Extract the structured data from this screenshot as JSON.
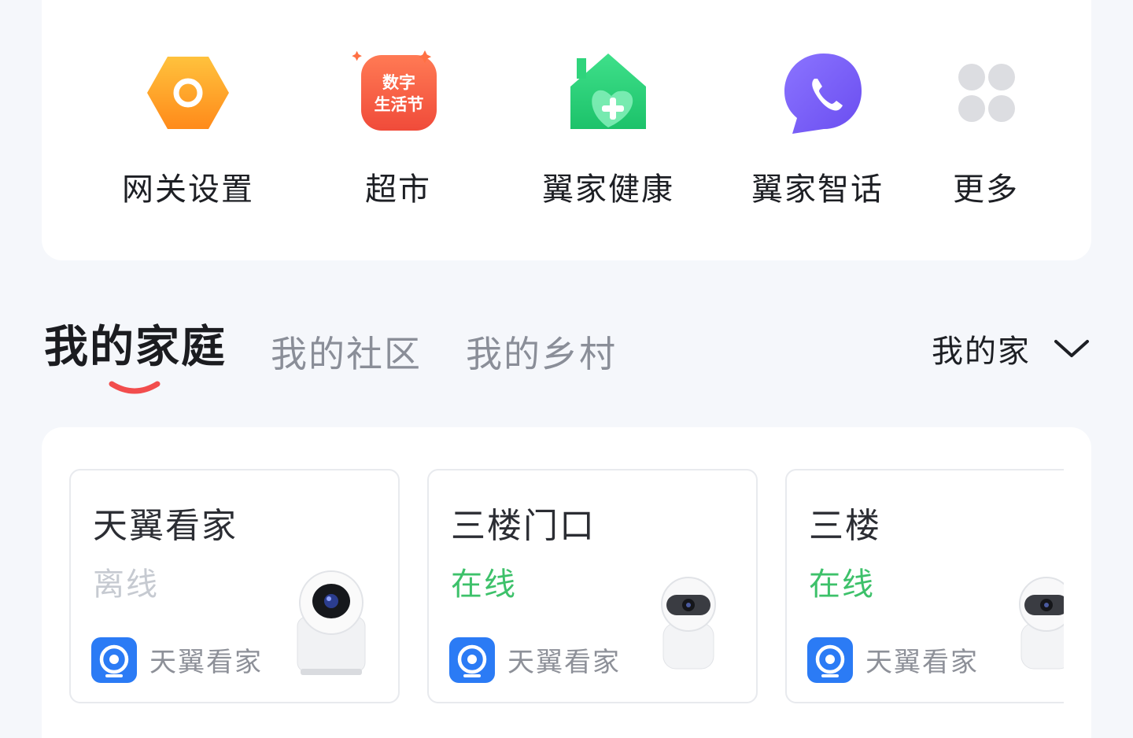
{
  "shortcuts": [
    {
      "label": "网关设置",
      "icon": "gateway-settings-icon"
    },
    {
      "label": "超市",
      "icon": "supermarket-icon",
      "icon_text_line1": "数字",
      "icon_text_line2": "生活节"
    },
    {
      "label": "翼家健康",
      "icon": "health-house-icon"
    },
    {
      "label": "翼家智话",
      "icon": "phone-chat-icon"
    },
    {
      "label": "更多",
      "icon": "more-grid-icon"
    }
  ],
  "tabs": [
    {
      "label": "我的家庭",
      "active": true
    },
    {
      "label": "我的社区",
      "active": false
    },
    {
      "label": "我的乡村",
      "active": false
    }
  ],
  "family_selector": {
    "label": "我的家"
  },
  "devices": [
    {
      "name": "天翼看家",
      "status": "离线",
      "online": false,
      "app": "天翼看家"
    },
    {
      "name": "三楼门口",
      "status": "在线",
      "online": true,
      "app": "天翼看家"
    },
    {
      "name": "三楼",
      "status": "在线",
      "online": true,
      "app": "天翼看家"
    }
  ],
  "colors": {
    "accent_red": "#f24d4d",
    "online_green": "#3dc16a",
    "offline_gray": "#c6cad1",
    "app_blue": "#2b7bf5"
  }
}
